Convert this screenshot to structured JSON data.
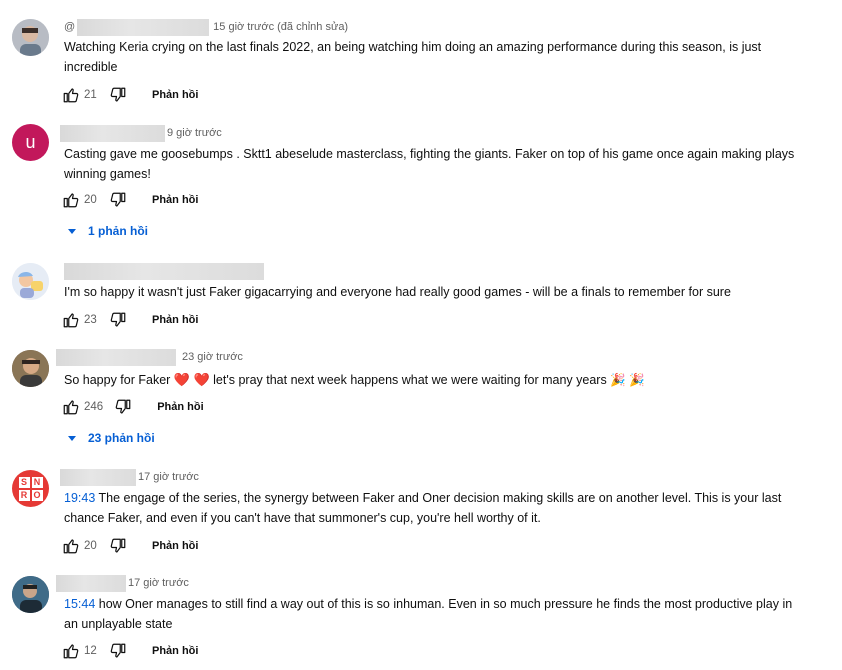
{
  "labels": {
    "reply": "Phản hồi"
  },
  "colors": {
    "link": "#065fd4",
    "meta": "#606060",
    "text": "#0f0f0f"
  },
  "comments": [
    {
      "time": "15 giờ trước (đã chỉnh sửa)",
      "prefix": "@",
      "text": "Watching Keria crying on the last finals 2022, an being watching him doing an amazing performance during this season, is just incredible",
      "likes": "21",
      "avatar": "person-avatar"
    },
    {
      "time": "9 giờ trước",
      "avatar_letter": "u",
      "text": "Casting gave me goosebumps . Sktt1 abeselude masterclass, fighting the giants. Faker on top of his game once again making plays winning games!",
      "likes": "20",
      "replies": "1 phản hồi"
    },
    {
      "text": "I'm so happy it wasn't just Faker gigacarrying and everyone had really good games - will be a finals to remember for sure",
      "likes": "23",
      "avatar": "cartoon-avatar"
    },
    {
      "time": "23 giờ trước",
      "text_before": "So happy for Faker",
      "text_mid": "let's pray that next week happens what we were waiting for many years",
      "emoji_heart": "❤️",
      "emoji_party": "🎉",
      "likes": "246",
      "replies": "23 phản hồi"
    },
    {
      "time": "17 giờ trước",
      "timestamp": "19:43",
      "text": "The engage of the series, the synergy between Faker and Oner decision making skills are on another level. This is your last chance Faker, and even if you can't have that summoner's cup, you're hell worthy of it.",
      "likes": "20",
      "avatar_logo": [
        "S",
        "N",
        "R",
        "O"
      ]
    },
    {
      "time": "17 giờ trước",
      "timestamp": "15:44",
      "text": "how Oner manages to still find a way out of this is so inhuman. Even in so much pressure he finds the most productive play in an unplayable state",
      "likes": "12"
    }
  ]
}
